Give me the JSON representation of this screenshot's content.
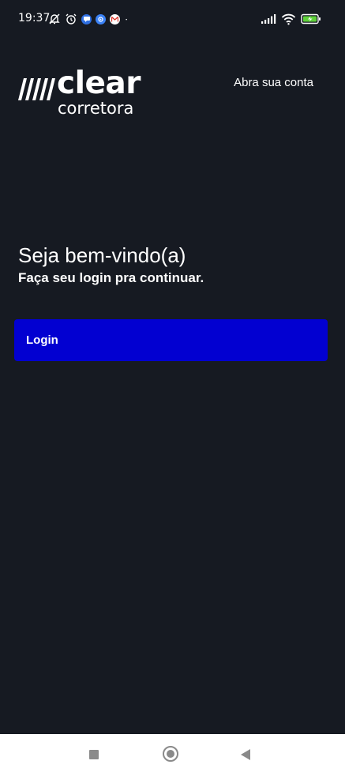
{
  "status_bar": {
    "time": "19:37",
    "left_icons": [
      "bell-off-icon",
      "alarm-icon",
      "chat-app-icon",
      "settings-app-icon",
      "gmail-icon",
      "more-dot-icon"
    ],
    "right_icons": [
      "signal-icon",
      "wifi-icon",
      "battery-charging-icon"
    ],
    "battery_color": "#5fd03a"
  },
  "header": {
    "logo_word": "clear",
    "logo_sub": "corretora",
    "open_account_link": "Abra sua conta"
  },
  "welcome": {
    "title": "Seja bem-vindo(a)",
    "subtitle": "Faça seu login pra continuar."
  },
  "login_button": {
    "label": "Login",
    "color": "#0200d1"
  },
  "nav_bar": {
    "icons": [
      "recents-icon",
      "home-icon",
      "back-icon"
    ]
  },
  "colors": {
    "background": "#161a22",
    "text": "#ffffff"
  }
}
